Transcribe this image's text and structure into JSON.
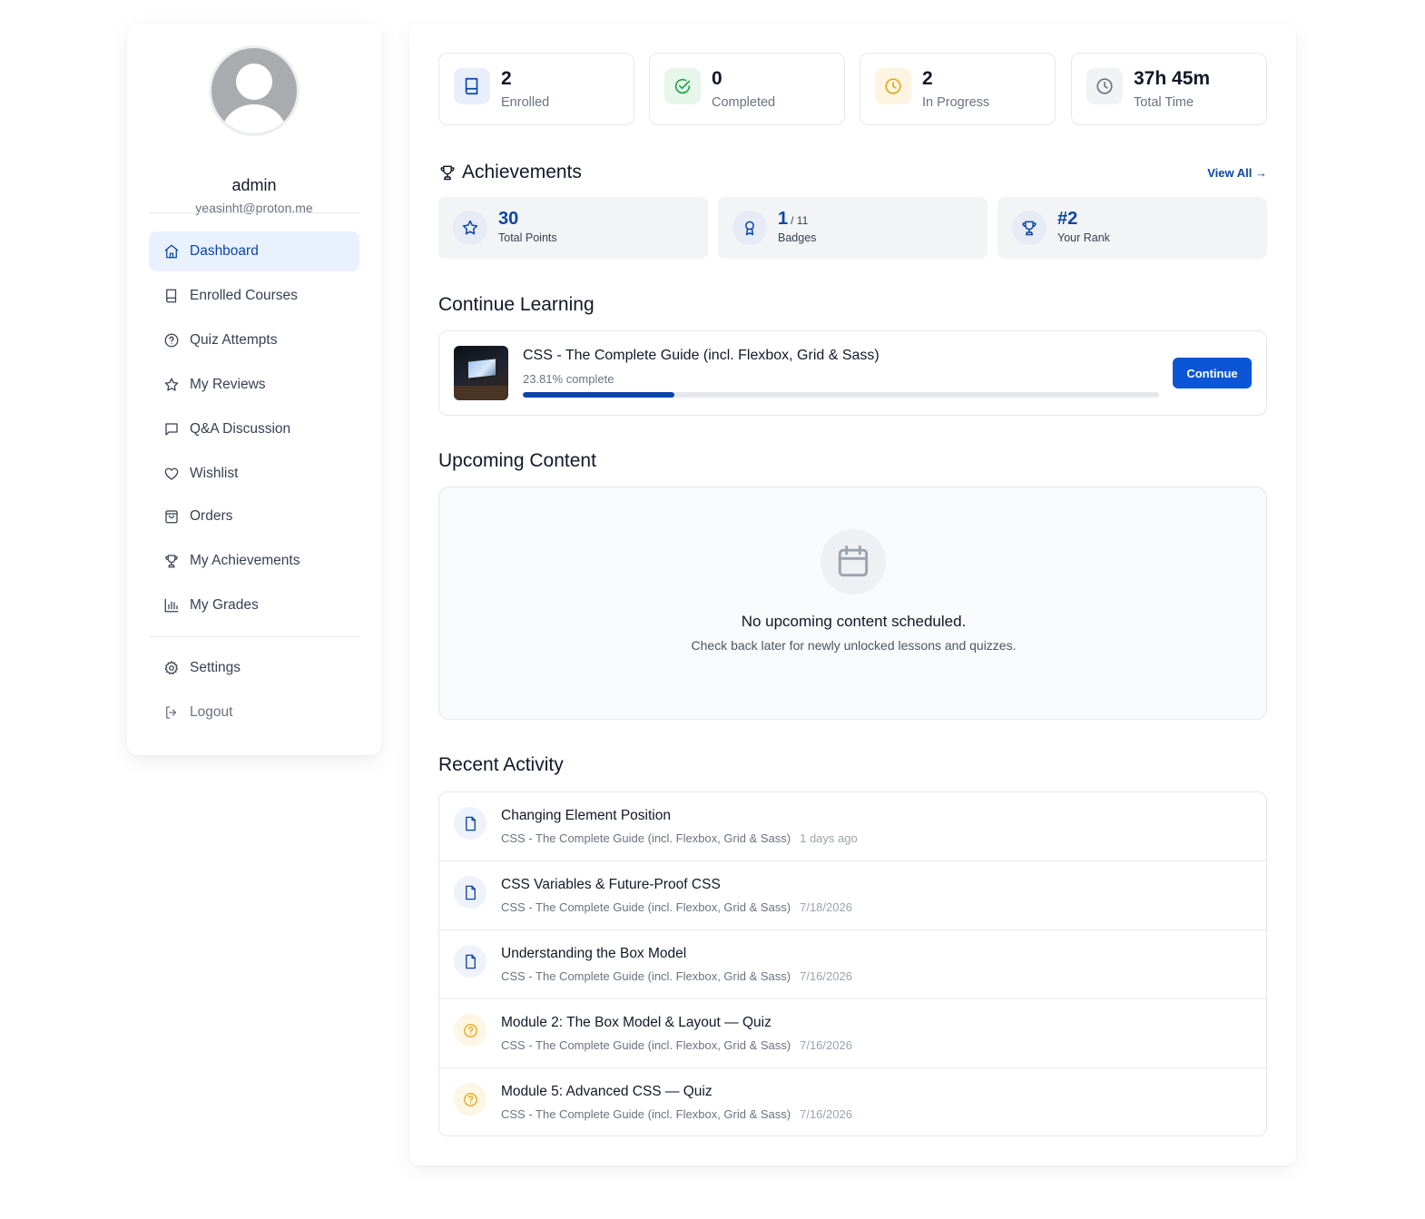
{
  "user": {
    "name": "admin",
    "email": "yeasinht@proton.me"
  },
  "nav": {
    "items": [
      {
        "label": "Dashboard",
        "icon": "home-icon",
        "active": true
      },
      {
        "label": "Enrolled Courses",
        "icon": "book-icon"
      },
      {
        "label": "Quiz Attempts",
        "icon": "help-circle-icon"
      },
      {
        "label": "My Reviews",
        "icon": "star-icon"
      },
      {
        "label": "Q&A Discussion",
        "icon": "message-square-icon"
      },
      {
        "label": "Wishlist",
        "icon": "heart-icon"
      },
      {
        "label": "Orders",
        "icon": "shopping-bag-icon"
      },
      {
        "label": "My Achievements",
        "icon": "trophy-icon"
      },
      {
        "label": "My Grades",
        "icon": "bar-chart-icon"
      }
    ],
    "bottom": [
      {
        "label": "Settings",
        "icon": "gear-icon"
      },
      {
        "label": "Logout",
        "icon": "logout-icon"
      }
    ]
  },
  "stats": [
    {
      "value": "2",
      "label": "Enrolled",
      "icon": "book-icon",
      "color": "#0b45a8",
      "bg": "#e8effb"
    },
    {
      "value": "0",
      "label": "Completed",
      "icon": "check-circle-icon",
      "color": "#22a447",
      "bg": "#e6f6ea"
    },
    {
      "value": "2",
      "label": "In Progress",
      "icon": "clock-icon",
      "color": "#e6a817",
      "bg": "#fdf4e1"
    },
    {
      "value": "37h 45m",
      "label": "Total Time",
      "icon": "clock-icon",
      "color": "#6b7280",
      "bg": "#f1f2f4"
    }
  ],
  "achievements": {
    "title": "Achievements",
    "view_all": "View All →",
    "cards": [
      {
        "value": "30",
        "suffix": "",
        "label": "Total Points",
        "icon": "star-icon"
      },
      {
        "value": "1",
        "suffix": "/ 11",
        "label": "Badges",
        "icon": "award-icon"
      },
      {
        "value": "#2",
        "suffix": "",
        "label": "Your Rank",
        "icon": "trophy-icon"
      }
    ]
  },
  "continue_learning": {
    "title": "Continue Learning",
    "course_title": "CSS - The Complete Guide (incl. Flexbox, Grid & Sass)",
    "progress_text": "23.81% complete",
    "progress_value": 23.81,
    "button_label": "Continue"
  },
  "upcoming": {
    "title": "Upcoming Content",
    "empty_title": "No upcoming content scheduled.",
    "empty_subtitle": "Check back later for newly unlocked lessons and quizzes."
  },
  "recent_activity": {
    "title": "Recent Activity",
    "items": [
      {
        "title": "Changing Element Position",
        "course": "CSS - The Complete Guide (incl. Flexbox, Grid & Sass)",
        "time": "1 days ago",
        "type": "lesson"
      },
      {
        "title": "CSS Variables & Future-Proof CSS",
        "course": "CSS - The Complete Guide (incl. Flexbox, Grid & Sass)",
        "time": "7/18/2026",
        "type": "lesson"
      },
      {
        "title": "Understanding the Box Model",
        "course": "CSS - The Complete Guide (incl. Flexbox, Grid & Sass)",
        "time": "7/16/2026",
        "type": "lesson"
      },
      {
        "title": "Module 2: The Box Model & Layout — Quiz",
        "course": "CSS - The Complete Guide (incl. Flexbox, Grid & Sass)",
        "time": "7/16/2026",
        "type": "quiz"
      },
      {
        "title": "Module 5: Advanced CSS — Quiz",
        "course": "CSS - The Complete Guide (incl. Flexbox, Grid & Sass)",
        "time": "7/16/2026",
        "type": "quiz"
      }
    ]
  }
}
